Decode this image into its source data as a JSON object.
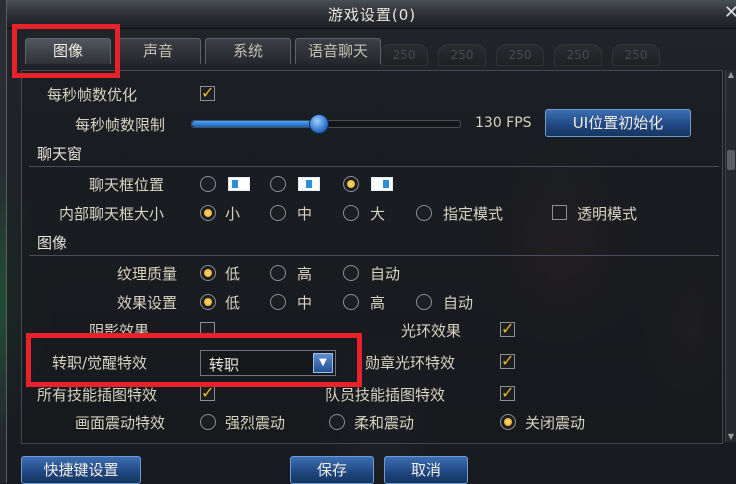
{
  "window": {
    "title": "游戏设置(0)"
  },
  "tabs": [
    {
      "label": "图像",
      "active": true
    },
    {
      "label": "声音",
      "active": false
    },
    {
      "label": "系统",
      "active": false
    },
    {
      "label": "语音聊天",
      "active": false
    }
  ],
  "background_badges": [
    "250",
    "250",
    "250",
    "250",
    "250"
  ],
  "perf": {
    "fps_opt_label": "每秒帧数优化",
    "fps_opt_checked": true,
    "fps_limit_label": "每秒帧数限制",
    "fps_limit_value_text": "130 FPS",
    "fps_slider_fraction": 0.47,
    "reset_ui_button": "UI位置初始化"
  },
  "chat": {
    "section_title": "聊天窗",
    "position_label": "聊天框位置",
    "position_selected": 2,
    "size_label": "内部聊天框大小",
    "size_options": [
      "小",
      "中",
      "大",
      "指定模式"
    ],
    "size_selected": 0,
    "transparent_label": "透明模式",
    "transparent_checked": false
  },
  "graphics": {
    "section_title": "图像",
    "texture_label": "纹理质量",
    "texture_options": [
      "低",
      "高",
      "自动"
    ],
    "texture_selected": 0,
    "effects_label": "效果设置",
    "effects_options": [
      "低",
      "中",
      "高",
      "自动"
    ],
    "effects_selected": 0,
    "shadow_label": "阴影效果",
    "shadow_checked": false,
    "aura_label": "光环效果",
    "aura_checked": true,
    "awaken_label": "转职/觉醒特效",
    "awaken_value": "转职",
    "medal_label": "勋章光环特效",
    "medal_checked": true,
    "skill_art_label": "所有技能插图特效",
    "skill_art_checked": true,
    "party_skill_label": "队员技能插图特效",
    "party_skill_checked": true,
    "shake_label": "画面震动特效",
    "shake_options": [
      "强烈震动",
      "柔和震动",
      "关闭震动"
    ],
    "shake_selected": 2
  },
  "footer": {
    "shortcut_button": "快捷键设置",
    "save_button": "保存",
    "cancel_button": "取消"
  },
  "colors": {
    "accent": "#f0b822",
    "highlight_box": "#e8222a",
    "button_blue": "#1f4680"
  }
}
